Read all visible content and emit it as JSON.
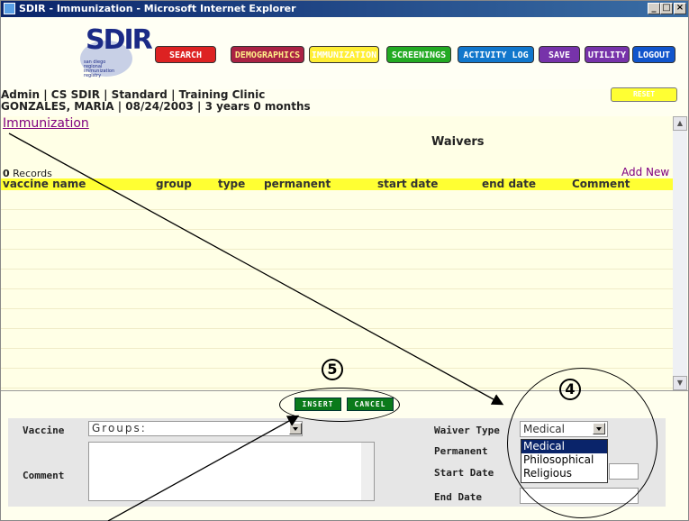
{
  "window": {
    "title": "SDIR - Immunization - Microsoft Internet Explorer",
    "min_label": "_",
    "max_label": "□",
    "close_label": "×"
  },
  "logo": {
    "big": "SDIR",
    "small": "san diego regional immunization registry"
  },
  "nav": [
    {
      "label": "SEARCH",
      "color": "#dd2222"
    },
    {
      "label": "DEMOGRAPHICS",
      "color": "#aa2244"
    },
    {
      "label": "IMMUNIZATION",
      "color": "#ffee33"
    },
    {
      "label": "SCREENINGS",
      "color": "#22aa22"
    },
    {
      "label": "ACTIVITY LOG",
      "color": "#1177cc"
    },
    {
      "label": "SAVE",
      "color": "#7733aa"
    },
    {
      "label": "UTILITY",
      "color": "#7733aa"
    },
    {
      "label": "LOGOUT",
      "color": "#1155cc"
    }
  ],
  "info": {
    "line1": "Admin | CS SDIR | Standard | Training Clinic",
    "line2": "GONZALES, MARIA | 08/24/2003 | 3 years 0 months"
  },
  "reset_label": "RESET",
  "section": {
    "link": "Immunization",
    "title": "Waivers",
    "records_count": "0",
    "records_word": "Records",
    "add_new": "Add New"
  },
  "columns": [
    "vaccine name",
    "group",
    "type",
    "permanent",
    "start date",
    "end date",
    "Comment"
  ],
  "buttons": {
    "insert": "INSERT",
    "cancel": "CANCEL"
  },
  "form": {
    "vaccine_label": "Vaccine",
    "vaccine_value": "Groups:",
    "comment_label": "Comment",
    "waiver_type_label": "Waiver Type",
    "waiver_type_value": "Medical",
    "waiver_options": [
      "Medical",
      "Philosophical",
      "Religious"
    ],
    "permanent_label": "Permanent",
    "start_date_label": "Start Date",
    "end_date_label": "End Date"
  },
  "annotations": {
    "four": "4",
    "five": "5"
  }
}
